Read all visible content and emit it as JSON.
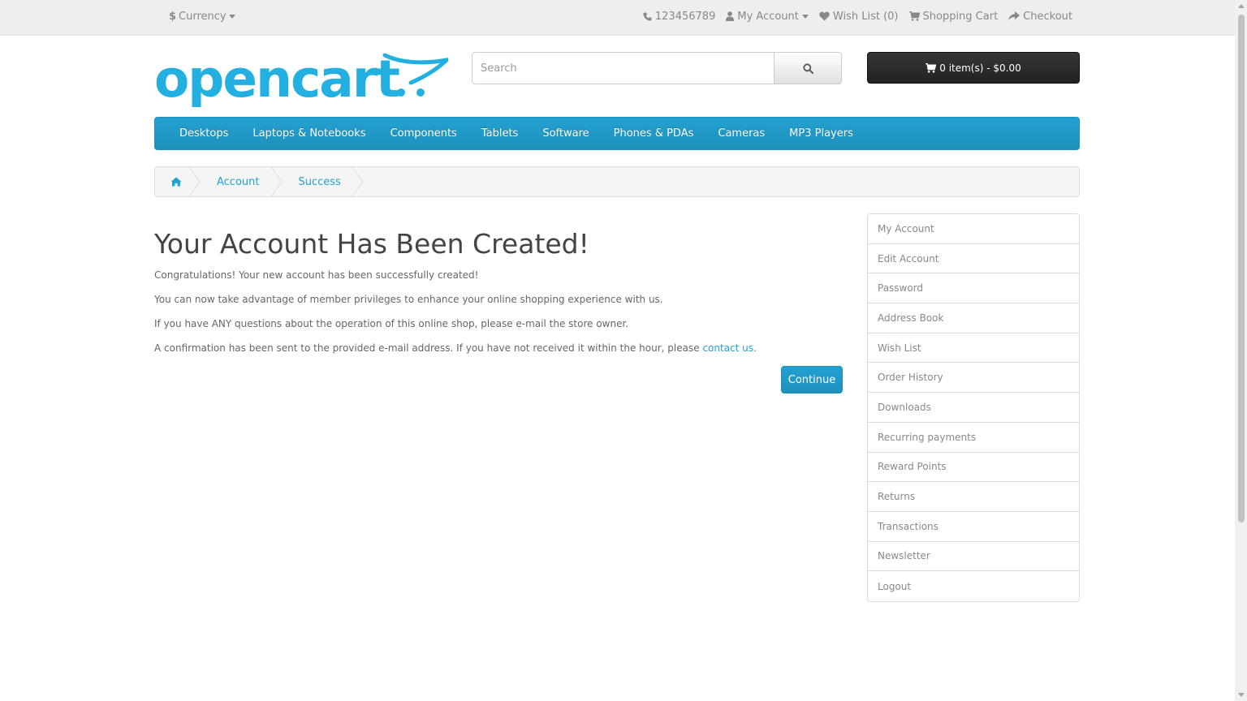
{
  "topbar": {
    "currency_symbol": "$",
    "currency_label": "Currency",
    "phone": "123456789",
    "my_account": "My Account",
    "wish_list": "Wish List (0)",
    "shopping_cart": "Shopping Cart",
    "checkout": "Checkout"
  },
  "header": {
    "logo_text": "opencart",
    "search_placeholder": "Search",
    "cart_label": "0 item(s) - $0.00"
  },
  "menu": {
    "items": [
      "Desktops",
      "Laptops & Notebooks",
      "Components",
      "Tablets",
      "Software",
      "Phones & PDAs",
      "Cameras",
      "MP3 Players"
    ]
  },
  "breadcrumb": {
    "items": [
      "Account",
      "Success"
    ]
  },
  "main": {
    "title": "Your Account Has Been Created!",
    "p1": "Congratulations! Your new account has been successfully created!",
    "p2": "You can now take advantage of member privileges to enhance your online shopping experience with us.",
    "p3": "If you have ANY questions about the operation of this online shop, please e-mail the store owner.",
    "p4_text": "A confirmation has been sent to the provided e-mail address. If you have not received it within the hour, please ",
    "p4_link": "contact us",
    "p4_end": ".",
    "continue_label": "Continue"
  },
  "sidebar": {
    "items": [
      "My Account",
      "Edit Account",
      "Password",
      "Address Book",
      "Wish List",
      "Order History",
      "Downloads",
      "Recurring payments",
      "Reward Points",
      "Returns",
      "Transactions",
      "Newsletter",
      "Logout"
    ]
  },
  "colors": {
    "accent": "#23a1d1",
    "topbar_bg": "#eeeeee",
    "cart_bg": "#2b2b2b"
  }
}
